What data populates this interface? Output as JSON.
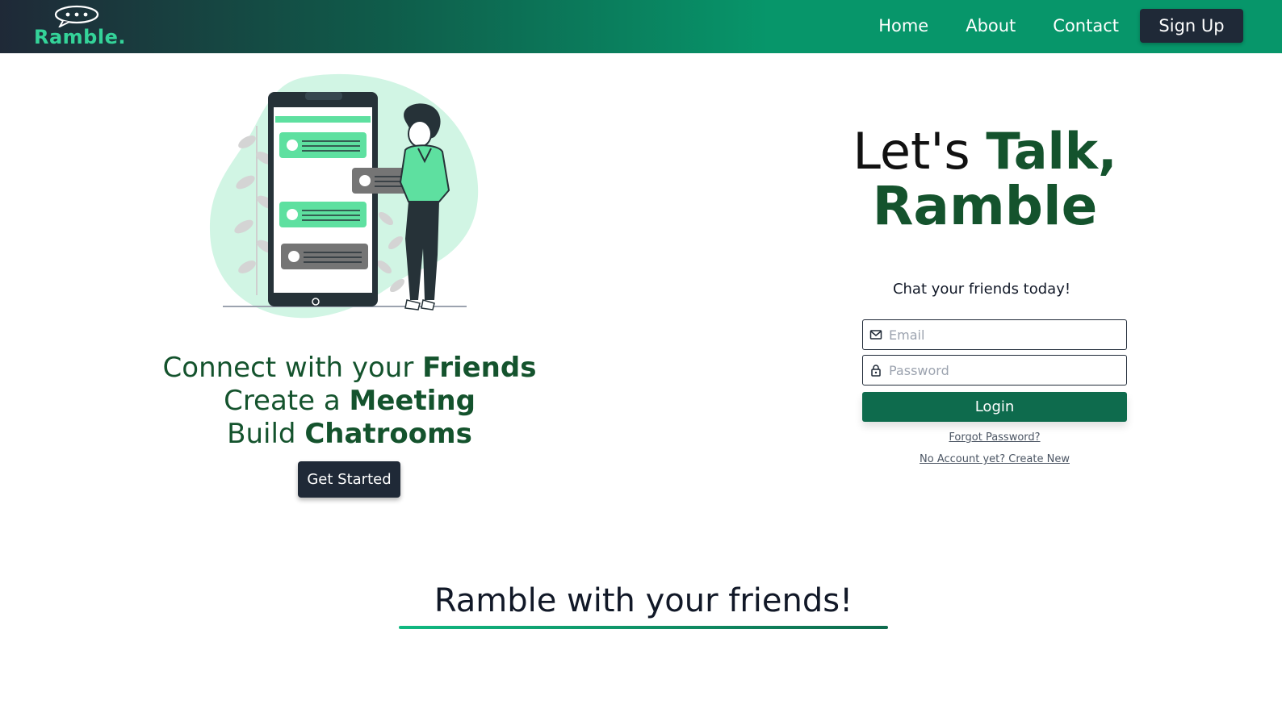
{
  "navbar": {
    "logo_text": "Ramble.",
    "links": [
      "Home",
      "About",
      "Contact"
    ],
    "signup_label": "Sign Up",
    "colors": {
      "gradient_start": "#1f2937",
      "gradient_end": "#07966a"
    }
  },
  "hero": {
    "line1_prefix": "Connect with your ",
    "line1_bold": "Friends",
    "line2_prefix": "Create a ",
    "line2_bold": "Meeting",
    "line3_prefix": "Build ",
    "line3_bold": "Chatrooms",
    "cta_label": "Get Started",
    "illustration": "person-with-phone-chat-illustration"
  },
  "login": {
    "title_prefix": "Let's ",
    "title_green": "Talk,",
    "title_line2": "Ramble",
    "tagline": "Chat your friends today!",
    "email_placeholder": "Email",
    "email_icon": "mail-icon",
    "password_placeholder": "Password",
    "password_icon": "lock-icon",
    "button_label": "Login",
    "forgot_link": "Forgot Password?",
    "create_link": "No Account yet? Create New"
  },
  "section": {
    "heading": "Ramble with your friends!"
  },
  "theme": {
    "primary_green": "#0e6b4d",
    "dark": "#1f2937",
    "text_green": "#14532d",
    "accent_mint": "#34d399"
  }
}
